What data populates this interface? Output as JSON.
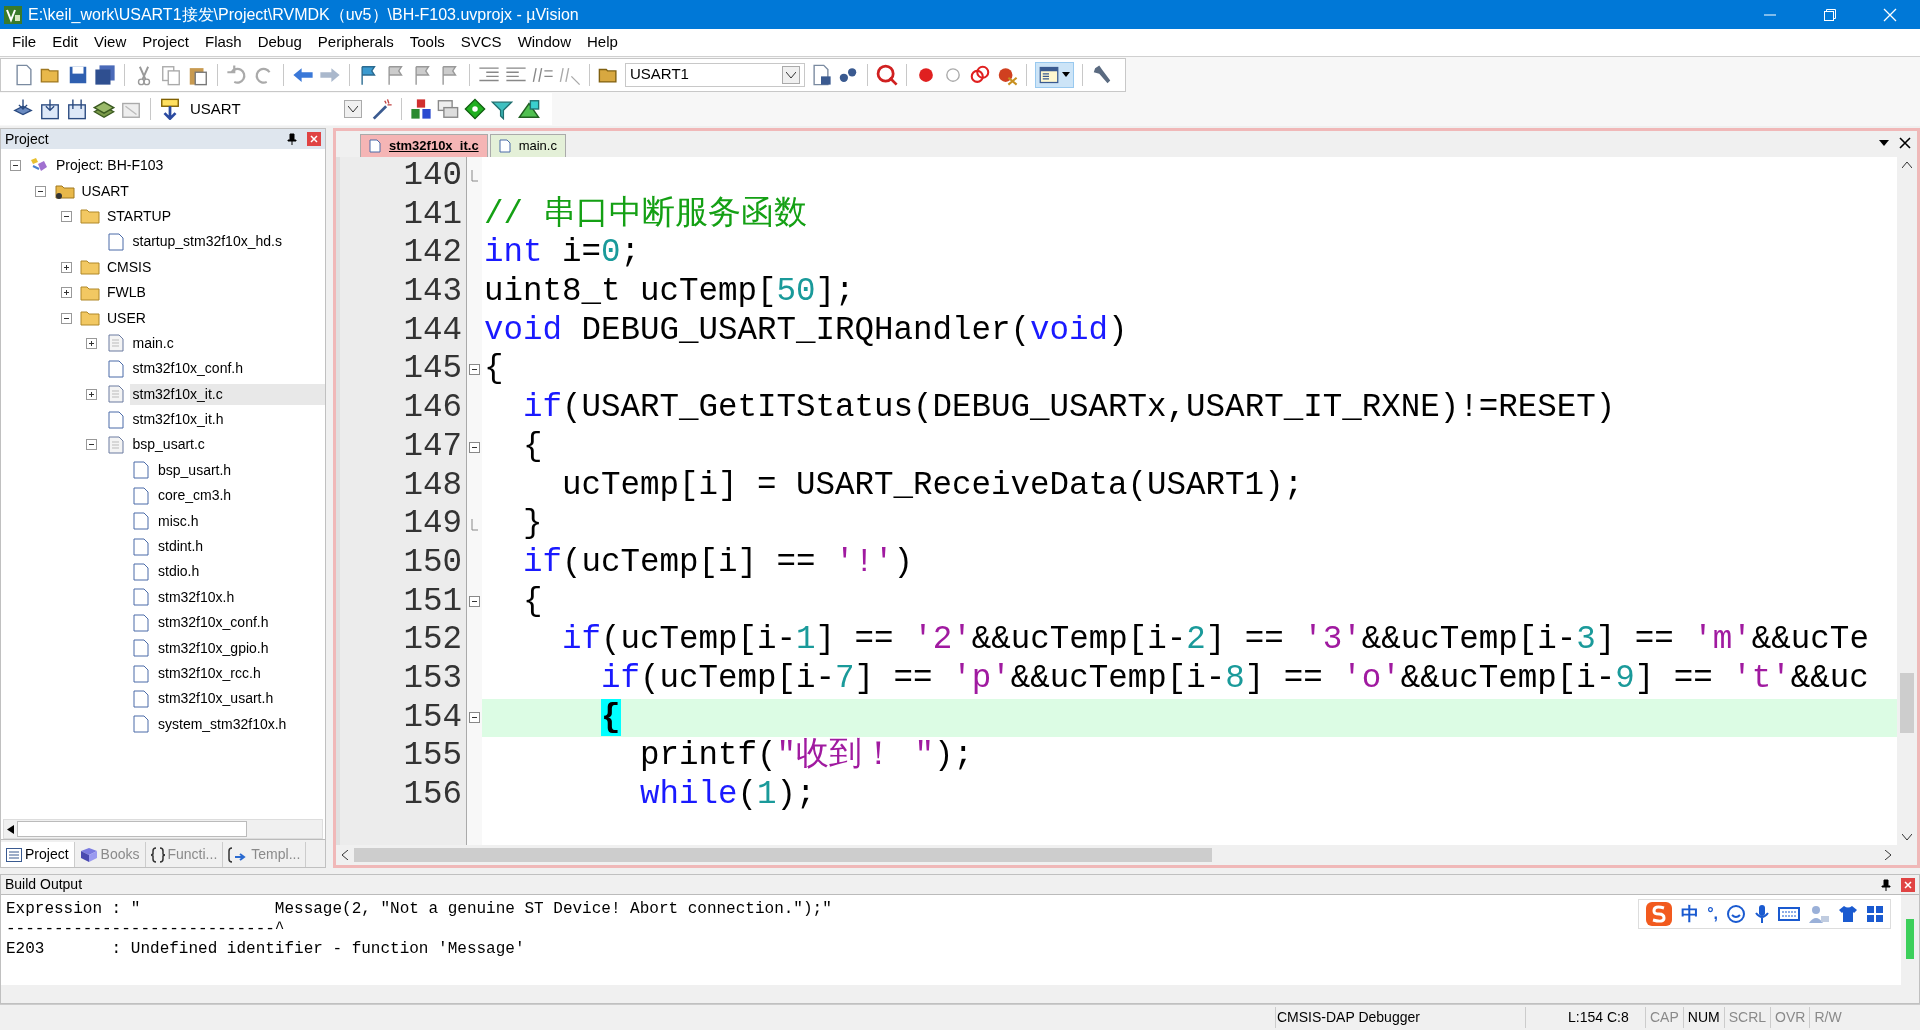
{
  "window": {
    "title": "E:\\keil_work\\USART1接发\\Project\\RVMDK（uv5）\\BH-F103.uvprojx - µVision"
  },
  "menu": [
    "File",
    "Edit",
    "View",
    "Project",
    "Flash",
    "Debug",
    "Peripherals",
    "Tools",
    "SVCS",
    "Window",
    "Help"
  ],
  "toolbar": {
    "target": "USART1"
  },
  "toolbar2": {
    "target": "USART"
  },
  "project_panel": {
    "title": "Project",
    "tree": [
      {
        "label": "Project: BH-F103",
        "kind": "project",
        "expanded": true,
        "selected": false,
        "children": [
          {
            "label": "USART",
            "kind": "target",
            "expanded": true,
            "selected": false,
            "children": [
              {
                "label": "STARTUP",
                "kind": "folder",
                "expanded": true,
                "selected": false,
                "children": [
                  {
                    "label": "startup_stm32f10x_hd.s",
                    "kind": "file",
                    "selected": false
                  }
                ]
              },
              {
                "label": "CMSIS",
                "kind": "folder",
                "expanded": false,
                "selected": false
              },
              {
                "label": "FWLB",
                "kind": "folder",
                "expanded": false,
                "selected": false
              },
              {
                "label": "USER",
                "kind": "folder",
                "expanded": true,
                "selected": false,
                "children": [
                  {
                    "label": "main.c",
                    "kind": "source",
                    "expanded": false,
                    "selected": false
                  },
                  {
                    "label": "stm32f10x_conf.h",
                    "kind": "file",
                    "selected": false
                  },
                  {
                    "label": "stm32f10x_it.c",
                    "kind": "source",
                    "expanded": false,
                    "selected": true
                  },
                  {
                    "label": "stm32f10x_it.h",
                    "kind": "file",
                    "selected": false
                  },
                  {
                    "label": "bsp_usart.c",
                    "kind": "source",
                    "expanded": true,
                    "selected": false,
                    "children": [
                      {
                        "label": "bsp_usart.h",
                        "kind": "file",
                        "selected": false
                      },
                      {
                        "label": "core_cm3.h",
                        "kind": "file",
                        "selected": false
                      },
                      {
                        "label": "misc.h",
                        "kind": "file",
                        "selected": false
                      },
                      {
                        "label": "stdint.h",
                        "kind": "file",
                        "selected": false
                      },
                      {
                        "label": "stdio.h",
                        "kind": "file",
                        "selected": false
                      },
                      {
                        "label": "stm32f10x.h",
                        "kind": "file",
                        "selected": false
                      },
                      {
                        "label": "stm32f10x_conf.h",
                        "kind": "file",
                        "selected": false
                      },
                      {
                        "label": "stm32f10x_gpio.h",
                        "kind": "file",
                        "selected": false
                      },
                      {
                        "label": "stm32f10x_rcc.h",
                        "kind": "file",
                        "selected": false
                      },
                      {
                        "label": "stm32f10x_usart.h",
                        "kind": "file",
                        "selected": false
                      },
                      {
                        "label": "system_stm32f10x.h",
                        "kind": "file",
                        "selected": false
                      }
                    ]
                  }
                ]
              }
            ]
          }
        ]
      }
    ],
    "tabs": [
      {
        "label": "Project",
        "kind": "project",
        "selected": true
      },
      {
        "label": "Books",
        "kind": "books",
        "selected": false
      },
      {
        "label": "Functi...",
        "kind": "functions",
        "selected": false
      },
      {
        "label": "Templ...",
        "kind": "templates",
        "selected": false
      }
    ]
  },
  "editor": {
    "tabs": [
      {
        "label": "stm32f10x_it.c",
        "selected": true
      },
      {
        "label": "main.c",
        "selected": false
      }
    ],
    "lines": [
      {
        "number": "140",
        "fold_start": false,
        "fold_end": true,
        "current": false
      },
      {
        "number": "141",
        "fold_start": false,
        "fold_end": false,
        "current": false,
        "tokens": [
          {
            "kind": "comment",
            "text": "// 串口中断服务函数"
          }
        ]
      },
      {
        "number": "142",
        "fold_start": false,
        "fold_end": false,
        "current": false,
        "tokens": [
          {
            "kind": "keyword",
            "text": "int"
          },
          {
            "kind": "plain",
            "text": " i="
          },
          {
            "kind": "number",
            "text": "0"
          },
          {
            "kind": "plain",
            "text": ";"
          }
        ]
      },
      {
        "number": "143",
        "fold_start": false,
        "fold_end": false,
        "current": false,
        "tokens": [
          {
            "kind": "plain",
            "text": "uint8_t ucTemp["
          },
          {
            "kind": "number",
            "text": "50"
          },
          {
            "kind": "plain",
            "text": "];"
          }
        ]
      },
      {
        "number": "144",
        "fold_start": false,
        "fold_end": false,
        "current": false,
        "tokens": [
          {
            "kind": "keyword",
            "text": "void"
          },
          {
            "kind": "plain",
            "text": " DEBUG_USART_IRQHandler("
          },
          {
            "kind": "keyword",
            "text": "void"
          },
          {
            "kind": "plain",
            "text": ")"
          }
        ]
      },
      {
        "number": "145",
        "fold_start": true,
        "fold_end": false,
        "current": false,
        "tokens": [
          {
            "kind": "plain",
            "text": "{"
          }
        ]
      },
      {
        "number": "146",
        "fold_start": false,
        "fold_end": false,
        "current": false,
        "tokens": [
          {
            "kind": "keyword",
            "text": "  if"
          },
          {
            "kind": "plain",
            "text": "(USART_GetITStatus(DEBUG_USARTx,USART_IT_RXNE)!=RESET)"
          }
        ]
      },
      {
        "number": "147",
        "fold_start": true,
        "fold_end": false,
        "current": false,
        "tokens": [
          {
            "kind": "plain",
            "text": "  {"
          }
        ]
      },
      {
        "number": "148",
        "fold_start": false,
        "fold_end": false,
        "current": false,
        "tokens": [
          {
            "kind": "plain",
            "text": "    ucTemp[i] = USART_ReceiveData(USART1);"
          }
        ]
      },
      {
        "number": "149",
        "fold_start": false,
        "fold_end": true,
        "current": false,
        "tokens": [
          {
            "kind": "plain",
            "text": "  }"
          }
        ]
      },
      {
        "number": "150",
        "fold_start": false,
        "fold_end": false,
        "current": false,
        "tokens": [
          {
            "kind": "keyword",
            "text": "  if"
          },
          {
            "kind": "plain",
            "text": "(ucTemp[i] == "
          },
          {
            "kind": "string",
            "text": "'!'"
          },
          {
            "kind": "plain",
            "text": ")"
          }
        ]
      },
      {
        "number": "151",
        "fold_start": true,
        "fold_end": false,
        "current": false,
        "tokens": [
          {
            "kind": "plain",
            "text": "  {"
          }
        ]
      },
      {
        "number": "152",
        "fold_start": false,
        "fold_end": false,
        "current": false,
        "tokens": [
          {
            "kind": "keyword",
            "text": "    if"
          },
          {
            "kind": "plain",
            "text": "(ucTemp[i-"
          },
          {
            "kind": "number",
            "text": "1"
          },
          {
            "kind": "plain",
            "text": "] == "
          },
          {
            "kind": "string",
            "text": "'2'"
          },
          {
            "kind": "plain",
            "text": "&&ucTemp[i-"
          },
          {
            "kind": "number",
            "text": "2"
          },
          {
            "kind": "plain",
            "text": "] == "
          },
          {
            "kind": "string",
            "text": "'3'"
          },
          {
            "kind": "plain",
            "text": "&&ucTemp[i-"
          },
          {
            "kind": "number",
            "text": "3"
          },
          {
            "kind": "plain",
            "text": "] == "
          },
          {
            "kind": "string",
            "text": "'m'"
          },
          {
            "kind": "plain",
            "text": "&&ucTe"
          }
        ]
      },
      {
        "number": "153",
        "fold_start": false,
        "fold_end": false,
        "current": false,
        "tokens": [
          {
            "kind": "keyword",
            "text": "      if"
          },
          {
            "kind": "plain",
            "text": "(ucTemp[i-"
          },
          {
            "kind": "number",
            "text": "7"
          },
          {
            "kind": "plain",
            "text": "] == "
          },
          {
            "kind": "string",
            "text": "'p'"
          },
          {
            "kind": "plain",
            "text": "&&ucTemp[i-"
          },
          {
            "kind": "number",
            "text": "8"
          },
          {
            "kind": "plain",
            "text": "] == "
          },
          {
            "kind": "string",
            "text": "'o'"
          },
          {
            "kind": "plain",
            "text": "&&ucTemp[i-"
          },
          {
            "kind": "number",
            "text": "9"
          },
          {
            "kind": "plain",
            "text": "] == "
          },
          {
            "kind": "string",
            "text": "'t'"
          },
          {
            "kind": "plain",
            "text": "&&uc"
          }
        ]
      },
      {
        "number": "154",
        "fold_start": true,
        "fold_end": false,
        "current": true,
        "tokens": [
          {
            "kind": "brace_match",
            "text": "      {"
          }
        ]
      },
      {
        "number": "155",
        "fold_start": false,
        "fold_end": false,
        "current": false,
        "tokens": [
          {
            "kind": "plain",
            "text": "        printf("
          },
          {
            "kind": "string",
            "text": "\"收到！ \""
          },
          {
            "kind": "plain",
            "text": ");"
          }
        ]
      },
      {
        "number": "156",
        "fold_start": false,
        "fold_end": false,
        "current": false,
        "tokens": [
          {
            "kind": "keyword",
            "text": "        while"
          },
          {
            "kind": "plain",
            "text": "("
          },
          {
            "kind": "number",
            "text": "1"
          },
          {
            "kind": "plain",
            "text": ");"
          }
        ]
      }
    ]
  },
  "build_output": {
    "title": "Build Output",
    "lines": [
      "Expression : \"              Message(2, \"Not a genuine ST Device! Abort connection.\");\"",
      "----------------------------^",
      "E203       : Undefined identifier - function 'Message'"
    ]
  },
  "ime_bar": {
    "mode": "中",
    "punctuation": "°,"
  },
  "status_bar": {
    "debugger": "CMSIS-DAP Debugger",
    "position": "L:154 C:8",
    "indicators": [
      {
        "label": "CAP",
        "on": false
      },
      {
        "label": "NUM",
        "on": true
      },
      {
        "label": "SCRL",
        "on": false
      },
      {
        "label": "OVR",
        "on": false
      },
      {
        "label": "R/W",
        "on": false
      }
    ]
  }
}
